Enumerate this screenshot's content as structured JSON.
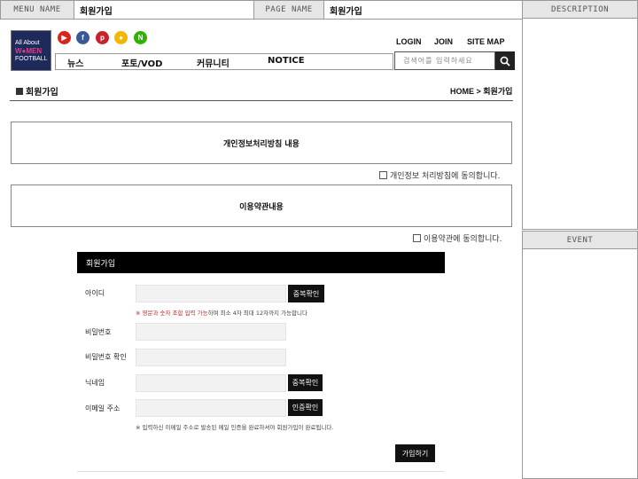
{
  "wire": {
    "menu_name_label": "MENU NAME",
    "menu_name_value": "회원가입",
    "page_name_label": "PAGE NAME",
    "page_name_value": "회원가입",
    "description_label": "DESCRIPTION",
    "event_label": "EVENT"
  },
  "logo": {
    "line1": "All About",
    "line2": "W●MEN",
    "line3": "FOOTBALL"
  },
  "sns_icons": [
    {
      "name": "youtube-icon",
      "glyph": "▶",
      "color": "#d7261e"
    },
    {
      "name": "facebook-icon",
      "glyph": "f",
      "color": "#3b5998"
    },
    {
      "name": "pinterest-icon",
      "glyph": "p",
      "color": "#c8232c"
    },
    {
      "name": "kakao-icon",
      "glyph": "●",
      "color": "#f2b705"
    },
    {
      "name": "naver-icon",
      "glyph": "N",
      "color": "#2db400"
    }
  ],
  "top_links": {
    "login": "LOGIN",
    "join": "JOIN",
    "sitemap": "SITE MAP"
  },
  "nav": [
    "뉴스",
    "포토/VOD",
    "커뮤니티",
    "NOTICE"
  ],
  "search": {
    "placeholder": "검색어를 입력하세요"
  },
  "page": {
    "title": "회원가입",
    "breadcrumb": "HOME > 회원가입"
  },
  "privacy": {
    "box_text": "개인정보처리방침 내용",
    "agree_text": "개인정보 처리방침에 동의합니다."
  },
  "terms": {
    "box_text": "이용약관내용",
    "agree_text": "이용약관에 동의합니다."
  },
  "form": {
    "heading": "회원가입",
    "id_label": "아이디",
    "id_check_button": "중복확인",
    "id_note_red": "※ 영문과 숫자 조합 입력 가능",
    "id_note_rest": "하며 최소 4자 최대 12자까지 가능합니다",
    "password_label": "비밀번호",
    "password_confirm_label": "비밀번호 확인",
    "nickname_label": "닉네임",
    "nickname_check_button": "중복확인",
    "email_label": "이메일 주소",
    "email_verify_button": "인증확인",
    "email_note": "※ 입력하신 이메일 주소로 발송된 메일 인증을 완료하셔야 회원가입이 완료됩니다.",
    "submit_button": "가입하기"
  }
}
